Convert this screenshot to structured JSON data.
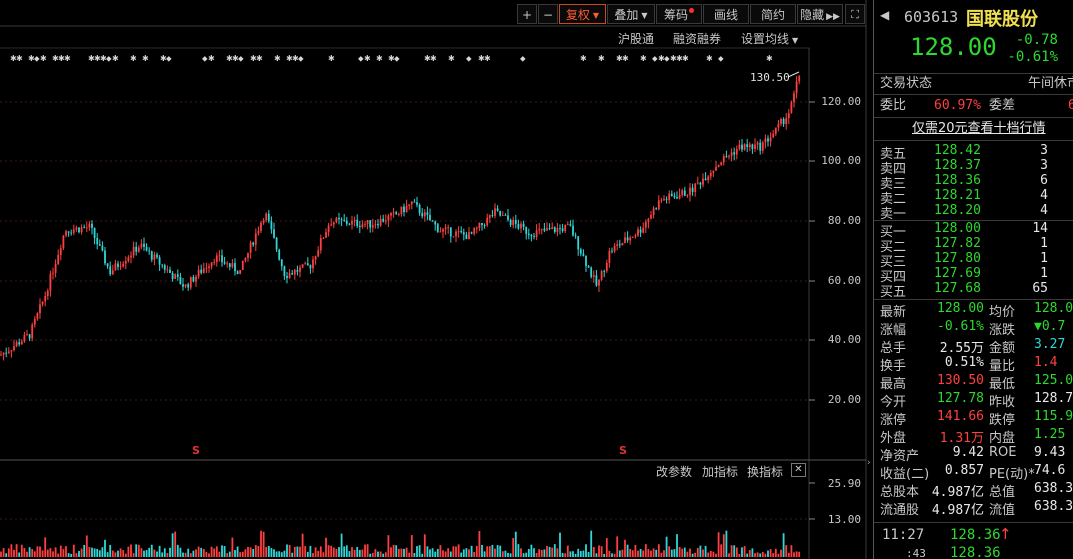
{
  "toolbar": {
    "plus": "+",
    "minus": "−",
    "fuquan": "复权",
    "diejia": "叠加",
    "chouma": "筹码",
    "huaxian": "画线",
    "jianyue": "简约",
    "yincang": "隐藏",
    "expand_icon": "fast-forward-icon",
    "fullscreen_icon": "fullscreen-icon"
  },
  "subtoolbar": {
    "hgt": "沪股通",
    "rzrq": "融资融券",
    "ma_settings": "设置均线"
  },
  "price_axis": [
    "120.00",
    "100.00",
    "80.00",
    "60.00",
    "40.00",
    "20.00"
  ],
  "max_label": "130.50",
  "indicator_toolbar": {
    "change_params": "改参数",
    "add_indicator": "加指标",
    "switch_indicator": "换指标",
    "close": "✕"
  },
  "volume_axis": [
    "25.90",
    "13.00"
  ],
  "signal_marks": [
    "S",
    "S"
  ],
  "colors": {
    "up": "#ff4040",
    "down": "#2fd8d8",
    "green": "#2fd82f",
    "accent": "#c84a1e"
  },
  "stock": {
    "code": "603613",
    "name": "国联股份",
    "price": "128.00",
    "change": "-0.78",
    "change_pct": "-0.61%"
  },
  "status": {
    "label": "交易状态",
    "value": "午间休市"
  },
  "weibi": {
    "label": "委比",
    "value": "60.97%",
    "diff_label": "委差",
    "diff_value": "6"
  },
  "promo": "仅需20元查看十档行情",
  "sell_orders": [
    {
      "label": "卖五",
      "price": "128.42",
      "vol": "3"
    },
    {
      "label": "卖四",
      "price": "128.37",
      "vol": "3"
    },
    {
      "label": "卖三",
      "price": "128.36",
      "vol": "6"
    },
    {
      "label": "卖二",
      "price": "128.21",
      "vol": "4"
    },
    {
      "label": "卖一",
      "price": "128.20",
      "vol": "4"
    }
  ],
  "buy_orders": [
    {
      "label": "买一",
      "price": "128.00",
      "vol": "14"
    },
    {
      "label": "买二",
      "price": "127.82",
      "vol": "1"
    },
    {
      "label": "买三",
      "price": "127.80",
      "vol": "1"
    },
    {
      "label": "买四",
      "price": "127.69",
      "vol": "1"
    },
    {
      "label": "买五",
      "price": "127.68",
      "vol": "65"
    }
  ],
  "quotes": [
    {
      "l1": "最新",
      "v1": "128.00",
      "c1": "green",
      "l2": "均价",
      "v2": "128.0",
      "c2": "green"
    },
    {
      "l1": "涨幅",
      "v1": "-0.61%",
      "c1": "green",
      "l2": "涨跌",
      "v2": "▼0.7",
      "c2": "green"
    },
    {
      "l1": "总手",
      "v1": "2.55万",
      "c1": "white",
      "l2": "金额",
      "v2": "3.27",
      "c2": "cyan"
    },
    {
      "l1": "换手",
      "v1": "0.51%",
      "c1": "white",
      "l2": "量比",
      "v2": "1.4",
      "c2": "red"
    },
    {
      "l1": "最高",
      "v1": "130.50",
      "c1": "red",
      "l2": "最低",
      "v2": "125.0",
      "c2": "green"
    },
    {
      "l1": "今开",
      "v1": "127.78",
      "c1": "green",
      "l2": "昨收",
      "v2": "128.7",
      "c2": "white"
    },
    {
      "l1": "涨停",
      "v1": "141.66",
      "c1": "red",
      "l2": "跌停",
      "v2": "115.9",
      "c2": "green"
    },
    {
      "l1": "外盘",
      "v1": "1.31万",
      "c1": "red",
      "l2": "内盘",
      "v2": "1.25",
      "c2": "green"
    },
    {
      "l1": "净资产",
      "v1": "9.42",
      "c1": "white",
      "l2": "ROE",
      "v2": "9.43",
      "c2": "white"
    },
    {
      "l1": "收益(二)",
      "v1": "0.857",
      "c1": "white",
      "l2": "PE(动)*",
      "v2": "74.6",
      "c2": "white"
    },
    {
      "l1": "总股本",
      "v1": "4.987亿",
      "c1": "white",
      "l2": "总值",
      "v2": "638.3",
      "c2": "white"
    },
    {
      "l1": "流通股",
      "v1": "4.987亿",
      "c1": "white",
      "l2": "流值",
      "v2": "638.3",
      "c2": "white"
    }
  ],
  "tick": {
    "time": "11:27",
    "price": "128.36",
    "arrow": "↑",
    "time2": ":43",
    "price2": "128.36"
  }
}
